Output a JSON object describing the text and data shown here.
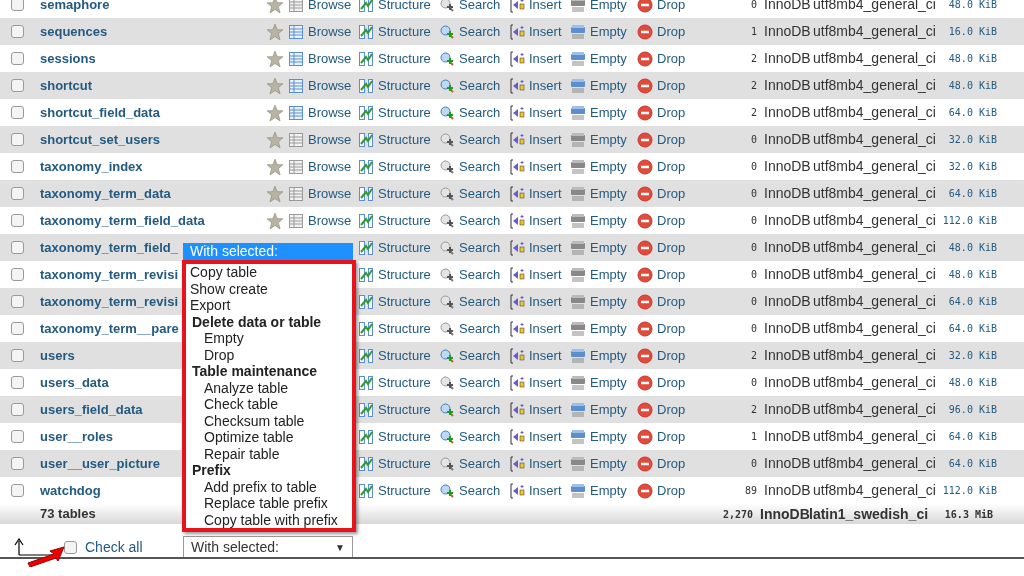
{
  "table": {
    "rows": [
      {
        "name": "semaphore",
        "checked": false,
        "active": false,
        "covered": false,
        "actions": [
          {
            "kind": "browse",
            "label": "Browse"
          },
          {
            "kind": "structure",
            "label": "Structure"
          },
          {
            "kind": "search",
            "label": "Search"
          },
          {
            "kind": "insert",
            "label": "Insert"
          },
          {
            "kind": "empty",
            "label": "Empty"
          },
          {
            "kind": "drop",
            "label": "Drop"
          }
        ],
        "rows": "0",
        "engine": "InnoDB",
        "collation": "utf8mb4_general_ci",
        "size": "48.0 KiB"
      },
      {
        "name": "sequences",
        "checked": false,
        "active": true,
        "covered": false,
        "actions": [
          {
            "kind": "browse",
            "label": "Browse"
          },
          {
            "kind": "structure",
            "label": "Structure"
          },
          {
            "kind": "search",
            "label": "Search"
          },
          {
            "kind": "insert",
            "label": "Insert"
          },
          {
            "kind": "empty",
            "label": "Empty"
          },
          {
            "kind": "drop",
            "label": "Drop"
          }
        ],
        "rows": "1",
        "engine": "InnoDB",
        "collation": "utf8mb4_general_ci",
        "size": "16.0 KiB"
      },
      {
        "name": "sessions",
        "checked": false,
        "active": true,
        "covered": false,
        "actions": [
          {
            "kind": "browse",
            "label": "Browse"
          },
          {
            "kind": "structure",
            "label": "Structure"
          },
          {
            "kind": "search",
            "label": "Search"
          },
          {
            "kind": "insert",
            "label": "Insert"
          },
          {
            "kind": "empty",
            "label": "Empty"
          },
          {
            "kind": "drop",
            "label": "Drop"
          }
        ],
        "rows": "2",
        "engine": "InnoDB",
        "collation": "utf8mb4_general_ci",
        "size": "48.0 KiB"
      },
      {
        "name": "shortcut",
        "checked": false,
        "active": true,
        "covered": false,
        "actions": [
          {
            "kind": "browse",
            "label": "Browse"
          },
          {
            "kind": "structure",
            "label": "Structure"
          },
          {
            "kind": "search",
            "label": "Search"
          },
          {
            "kind": "insert",
            "label": "Insert"
          },
          {
            "kind": "empty",
            "label": "Empty"
          },
          {
            "kind": "drop",
            "label": "Drop"
          }
        ],
        "rows": "2",
        "engine": "InnoDB",
        "collation": "utf8mb4_general_ci",
        "size": "48.0 KiB"
      },
      {
        "name": "shortcut_field_data",
        "checked": false,
        "active": true,
        "covered": false,
        "actions": [
          {
            "kind": "browse",
            "label": "Browse"
          },
          {
            "kind": "structure",
            "label": "Structure"
          },
          {
            "kind": "search",
            "label": "Search"
          },
          {
            "kind": "insert",
            "label": "Insert"
          },
          {
            "kind": "empty",
            "label": "Empty"
          },
          {
            "kind": "drop",
            "label": "Drop"
          }
        ],
        "rows": "2",
        "engine": "InnoDB",
        "collation": "utf8mb4_general_ci",
        "size": "64.0 KiB"
      },
      {
        "name": "shortcut_set_users",
        "checked": false,
        "active": false,
        "covered": false,
        "actions": [
          {
            "kind": "browse",
            "label": "Browse"
          },
          {
            "kind": "structure",
            "label": "Structure"
          },
          {
            "kind": "search",
            "label": "Search"
          },
          {
            "kind": "insert",
            "label": "Insert"
          },
          {
            "kind": "empty",
            "label": "Empty"
          },
          {
            "kind": "drop",
            "label": "Drop"
          }
        ],
        "rows": "0",
        "engine": "InnoDB",
        "collation": "utf8mb4_general_ci",
        "size": "32.0 KiB"
      },
      {
        "name": "taxonomy_index",
        "checked": false,
        "active": false,
        "covered": false,
        "actions": [
          {
            "kind": "browse",
            "label": "Browse"
          },
          {
            "kind": "structure",
            "label": "Structure"
          },
          {
            "kind": "search",
            "label": "Search"
          },
          {
            "kind": "insert",
            "label": "Insert"
          },
          {
            "kind": "empty",
            "label": "Empty"
          },
          {
            "kind": "drop",
            "label": "Drop"
          }
        ],
        "rows": "0",
        "engine": "InnoDB",
        "collation": "utf8mb4_general_ci",
        "size": "32.0 KiB"
      },
      {
        "name": "taxonomy_term_data",
        "checked": false,
        "active": false,
        "covered": false,
        "actions": [
          {
            "kind": "browse",
            "label": "Browse"
          },
          {
            "kind": "structure",
            "label": "Structure"
          },
          {
            "kind": "search",
            "label": "Search"
          },
          {
            "kind": "insert",
            "label": "Insert"
          },
          {
            "kind": "empty",
            "label": "Empty"
          },
          {
            "kind": "drop",
            "label": "Drop"
          }
        ],
        "rows": "0",
        "engine": "InnoDB",
        "collation": "utf8mb4_general_ci",
        "size": "64.0 KiB"
      },
      {
        "name": "taxonomy_term_field_data",
        "checked": false,
        "active": false,
        "covered": false,
        "actions": [
          {
            "kind": "browse",
            "label": "Browse"
          },
          {
            "kind": "structure",
            "label": "Structure"
          },
          {
            "kind": "search",
            "label": "Search"
          },
          {
            "kind": "insert",
            "label": "Insert"
          },
          {
            "kind": "empty",
            "label": "Empty"
          },
          {
            "kind": "drop",
            "label": "Drop"
          }
        ],
        "rows": "0",
        "engine": "InnoDB",
        "collation": "utf8mb4_general_ci",
        "size": "112.0 KiB"
      },
      {
        "name": "taxonomy_term_field_",
        "checked": false,
        "active": false,
        "covered": true,
        "actions": [
          {
            "kind": "structure",
            "label": "Structure"
          },
          {
            "kind": "search",
            "label": "Search"
          },
          {
            "kind": "insert",
            "label": "Insert"
          },
          {
            "kind": "empty",
            "label": "Empty"
          },
          {
            "kind": "drop",
            "label": "Drop"
          }
        ],
        "rows": "0",
        "engine": "InnoDB",
        "collation": "utf8mb4_general_ci",
        "size": "48.0 KiB"
      },
      {
        "name": "taxonomy_term_revisi",
        "checked": false,
        "active": false,
        "covered": true,
        "actions": [
          {
            "kind": "structure",
            "label": "Structure"
          },
          {
            "kind": "search",
            "label": "Search"
          },
          {
            "kind": "insert",
            "label": "Insert"
          },
          {
            "kind": "empty",
            "label": "Empty"
          },
          {
            "kind": "drop",
            "label": "Drop"
          }
        ],
        "rows": "0",
        "engine": "InnoDB",
        "collation": "utf8mb4_general_ci",
        "size": "48.0 KiB"
      },
      {
        "name": "taxonomy_term_revisi",
        "checked": false,
        "active": false,
        "covered": true,
        "actions": [
          {
            "kind": "structure",
            "label": "Structure"
          },
          {
            "kind": "search",
            "label": "Search"
          },
          {
            "kind": "insert",
            "label": "Insert"
          },
          {
            "kind": "empty",
            "label": "Empty"
          },
          {
            "kind": "drop",
            "label": "Drop"
          }
        ],
        "rows": "0",
        "engine": "InnoDB",
        "collation": "utf8mb4_general_ci",
        "size": "64.0 KiB"
      },
      {
        "name": "taxonomy_term__pare",
        "checked": false,
        "active": false,
        "covered": true,
        "actions": [
          {
            "kind": "structure",
            "label": "Structure"
          },
          {
            "kind": "search",
            "label": "Search"
          },
          {
            "kind": "insert",
            "label": "Insert"
          },
          {
            "kind": "empty",
            "label": "Empty"
          },
          {
            "kind": "drop",
            "label": "Drop"
          }
        ],
        "rows": "0",
        "engine": "InnoDB",
        "collation": "utf8mb4_general_ci",
        "size": "64.0 KiB"
      },
      {
        "name": "users",
        "checked": false,
        "active": true,
        "covered": true,
        "actions": [
          {
            "kind": "structure",
            "label": "Structure"
          },
          {
            "kind": "search",
            "label": "Search"
          },
          {
            "kind": "insert",
            "label": "Insert"
          },
          {
            "kind": "empty",
            "label": "Empty"
          },
          {
            "kind": "drop",
            "label": "Drop"
          }
        ],
        "rows": "2",
        "engine": "InnoDB",
        "collation": "utf8mb4_general_ci",
        "size": "32.0 KiB"
      },
      {
        "name": "users_data",
        "checked": false,
        "active": false,
        "covered": true,
        "actions": [
          {
            "kind": "structure",
            "label": "Structure"
          },
          {
            "kind": "search",
            "label": "Search"
          },
          {
            "kind": "insert",
            "label": "Insert"
          },
          {
            "kind": "empty",
            "label": "Empty"
          },
          {
            "kind": "drop",
            "label": "Drop"
          }
        ],
        "rows": "0",
        "engine": "InnoDB",
        "collation": "utf8mb4_general_ci",
        "size": "48.0 KiB"
      },
      {
        "name": "users_field_data",
        "checked": false,
        "active": true,
        "covered": true,
        "actions": [
          {
            "kind": "structure",
            "label": "Structure"
          },
          {
            "kind": "search",
            "label": "Search"
          },
          {
            "kind": "insert",
            "label": "Insert"
          },
          {
            "kind": "empty",
            "label": "Empty"
          },
          {
            "kind": "drop",
            "label": "Drop"
          }
        ],
        "rows": "2",
        "engine": "InnoDB",
        "collation": "utf8mb4_general_ci",
        "size": "96.0 KiB"
      },
      {
        "name": "user__roles",
        "checked": false,
        "active": true,
        "covered": true,
        "actions": [
          {
            "kind": "structure",
            "label": "Structure"
          },
          {
            "kind": "search",
            "label": "Search"
          },
          {
            "kind": "insert",
            "label": "Insert"
          },
          {
            "kind": "empty",
            "label": "Empty"
          },
          {
            "kind": "drop",
            "label": "Drop"
          }
        ],
        "rows": "1",
        "engine": "InnoDB",
        "collation": "utf8mb4_general_ci",
        "size": "64.0 KiB"
      },
      {
        "name": "user__user_picture",
        "checked": false,
        "active": false,
        "covered": true,
        "actions": [
          {
            "kind": "structure",
            "label": "Structure"
          },
          {
            "kind": "search",
            "label": "Search"
          },
          {
            "kind": "insert",
            "label": "Insert"
          },
          {
            "kind": "empty",
            "label": "Empty"
          },
          {
            "kind": "drop",
            "label": "Drop"
          }
        ],
        "rows": "0",
        "engine": "InnoDB",
        "collation": "utf8mb4_general_ci",
        "size": "64.0 KiB"
      },
      {
        "name": "watchdog",
        "checked": false,
        "active": true,
        "covered": true,
        "actions": [
          {
            "kind": "structure",
            "label": "Structure"
          },
          {
            "kind": "search",
            "label": "Search"
          },
          {
            "kind": "insert",
            "label": "Insert"
          },
          {
            "kind": "empty",
            "label": "Empty"
          },
          {
            "kind": "drop",
            "label": "Drop"
          }
        ],
        "rows": "89",
        "engine": "InnoDB",
        "collation": "utf8mb4_general_ci",
        "size": "112.0 KiB"
      }
    ],
    "footer": {
      "label": "73 tables",
      "rows": "2,270",
      "engine": "InnoDB",
      "collation": "latin1_swedish_ci",
      "size": "16.3 MiB"
    }
  },
  "check_all": {
    "label": "Check all",
    "checked": false
  },
  "with_selected": {
    "value": "With selected:",
    "caret": "▼"
  },
  "dropdown": {
    "header": "With selected:",
    "items": [
      {
        "kind": "option",
        "label": "Copy table"
      },
      {
        "kind": "option",
        "label": "Show create"
      },
      {
        "kind": "option",
        "label": "Export"
      },
      {
        "kind": "group",
        "label": "Delete data or table",
        "children": [
          {
            "label": "Empty"
          },
          {
            "label": "Drop"
          }
        ]
      },
      {
        "kind": "group",
        "label": "Table maintenance",
        "children": [
          {
            "label": "Analyze table"
          },
          {
            "label": "Check table"
          },
          {
            "label": "Checksum table"
          },
          {
            "label": "Optimize table"
          },
          {
            "label": "Repair table"
          }
        ]
      },
      {
        "kind": "group",
        "label": "Prefix",
        "children": [
          {
            "label": "Add prefix to table"
          },
          {
            "label": "Replace table prefix"
          },
          {
            "label": "Copy table with prefix"
          }
        ]
      }
    ]
  }
}
